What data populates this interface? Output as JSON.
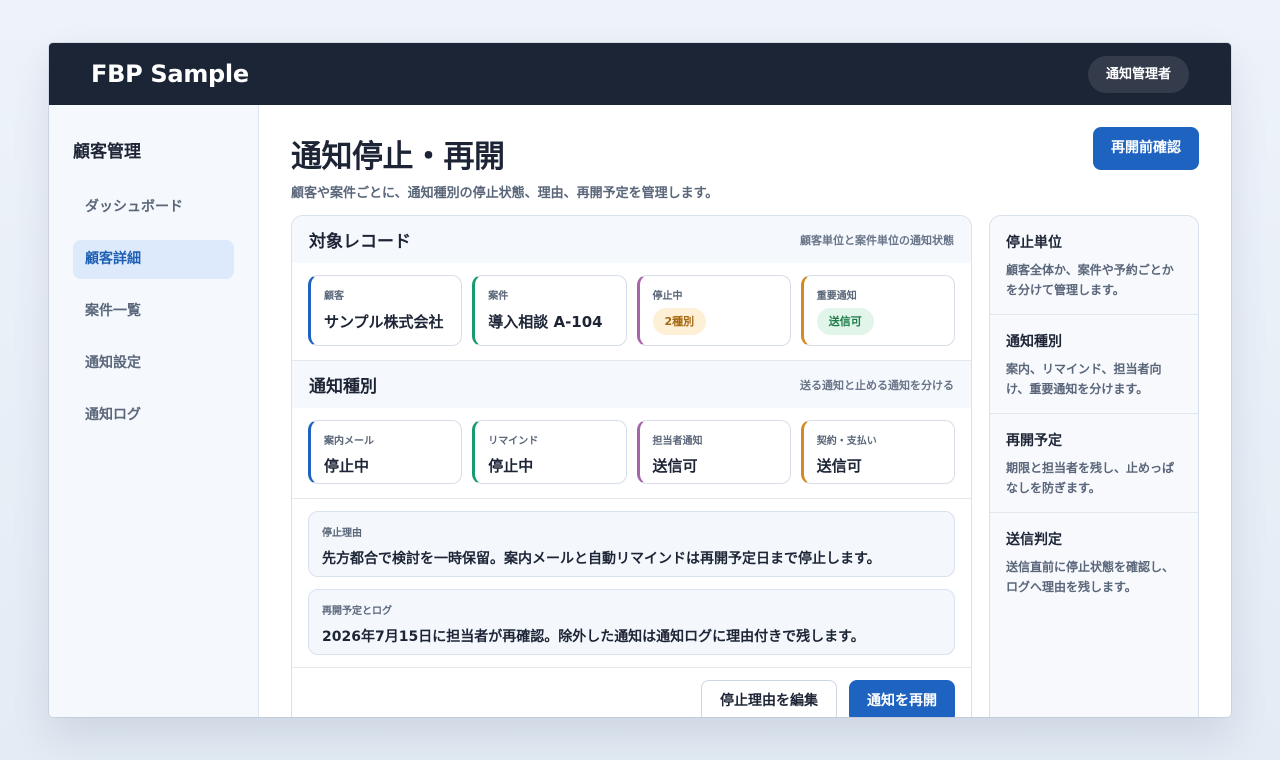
{
  "app": {
    "brand": "FBP Sample",
    "user_role": "通知管理者"
  },
  "sidebar": {
    "title": "顧客管理",
    "items": [
      {
        "label": "ダッシュボード",
        "active": false
      },
      {
        "label": "顧客詳細",
        "active": true
      },
      {
        "label": "案件一覧",
        "active": false
      },
      {
        "label": "通知設定",
        "active": false
      },
      {
        "label": "通知ログ",
        "active": false
      }
    ]
  },
  "page": {
    "title": "通知停止・再開",
    "subtitle": "顧客や案件ごとに、通知種別の停止状態、理由、再開予定を管理します。",
    "confirm_button": "再開前確認"
  },
  "target_record": {
    "title": "対象レコード",
    "note": "顧客単位と案件単位の通知状態",
    "tiles": [
      {
        "label": "顧客",
        "value": "サンプル株式会社"
      },
      {
        "label": "案件",
        "value": "導入相談 A-104"
      },
      {
        "label": "停止中",
        "badge": "2種別"
      },
      {
        "label": "重要通知",
        "badge": "送信可"
      }
    ]
  },
  "notification_types": {
    "title": "通知種別",
    "note": "送る通知と止める通知を分ける",
    "tiles": [
      {
        "label": "案内メール",
        "value": "停止中"
      },
      {
        "label": "リマインド",
        "value": "停止中"
      },
      {
        "label": "担当者通知",
        "value": "送信可"
      },
      {
        "label": "契約・支払い",
        "value": "送信可"
      }
    ]
  },
  "notes": [
    {
      "label": "停止理由",
      "text": "先方都合で検討を一時保留。案内メールと自動リマインドは再開予定日まで停止します。"
    },
    {
      "label": "再開予定とログ",
      "text": "2026年7月15日に担当者が再確認。除外した通知は通知ログに理由付きで残します。"
    }
  ],
  "actions": {
    "edit_label": "停止理由を編集",
    "resume_label": "通知を再開"
  },
  "side_panel": [
    {
      "title": "停止単位",
      "text": "顧客全体か、案件や予約ごとかを分けて管理します。"
    },
    {
      "title": "通知種別",
      "text": "案内、リマインド、担当者向け、重要通知を分けます。"
    },
    {
      "title": "再開予定",
      "text": "期限と担当者を残し、止めっぱなしを防ぎます。"
    },
    {
      "title": "送信判定",
      "text": "送信直前に停止状態を確認し、ログへ理由を残します。"
    }
  ],
  "colors": {
    "topbar": "#1c2536",
    "primary": "#1f63c1",
    "accent_blue": "#1f63c1",
    "accent_green": "#1a9a73",
    "accent_purple": "#a565a8",
    "accent_orange": "#d38a22"
  }
}
